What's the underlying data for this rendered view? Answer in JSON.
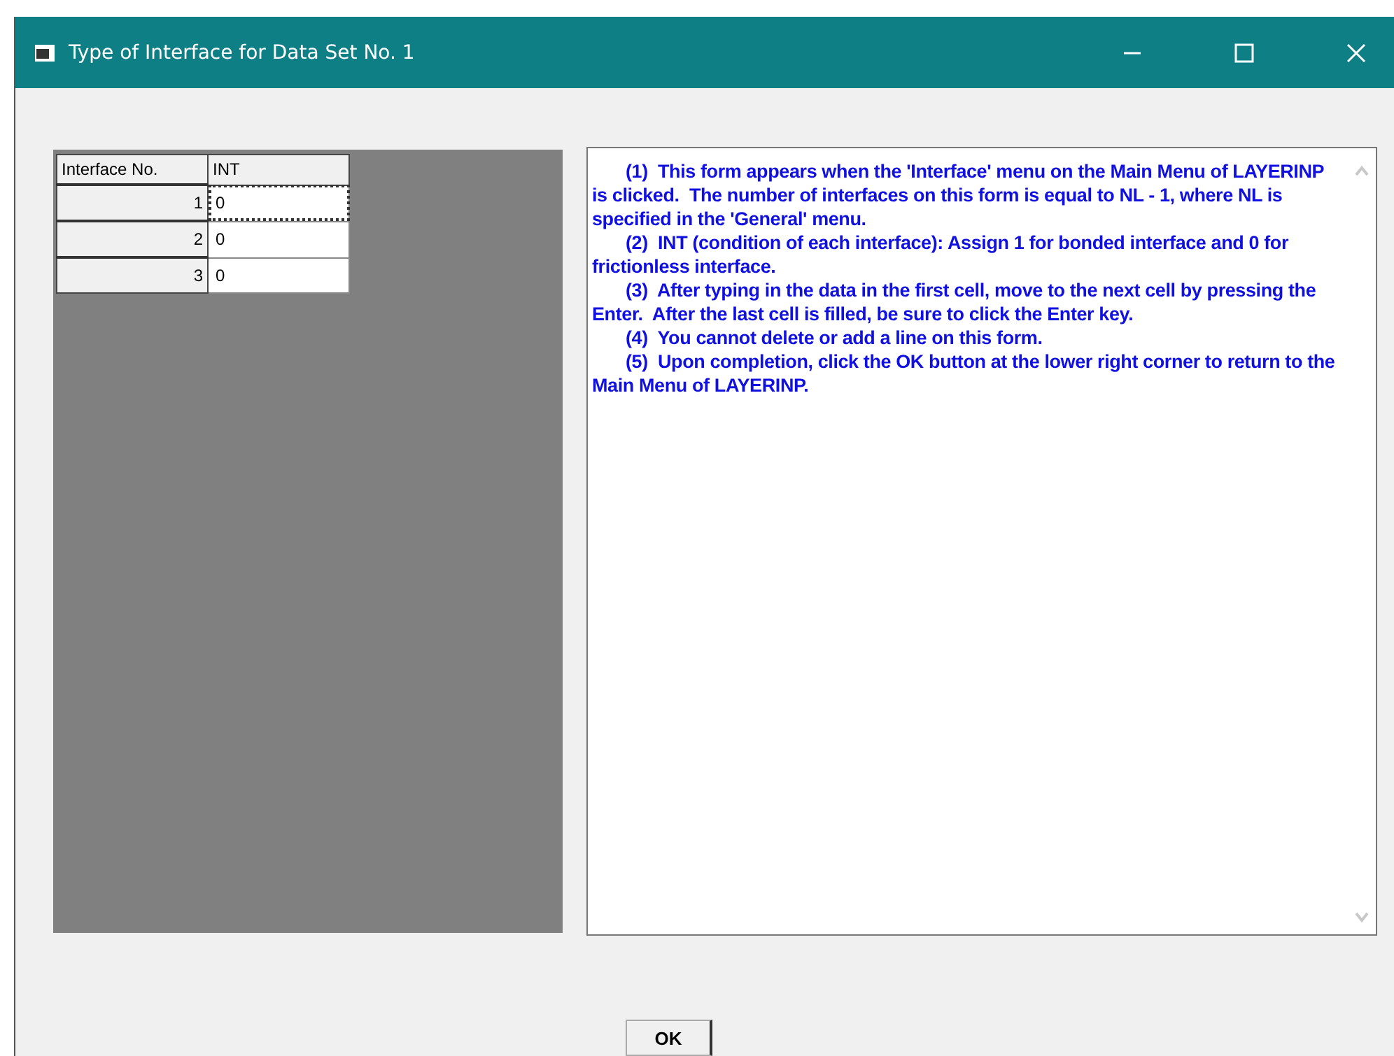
{
  "window": {
    "title": "Type of Interface for Data Set No. 1"
  },
  "table": {
    "columns": [
      "Interface No.",
      "INT"
    ],
    "rows": [
      {
        "number": "1",
        "int": "0",
        "focused": true
      },
      {
        "number": "2",
        "int": "0",
        "focused": false
      },
      {
        "number": "3",
        "int": "0",
        "focused": false
      }
    ]
  },
  "instructions": [
    "(1)  This form appears when the 'Interface' menu on the Main Menu of LAYERINP is clicked.  The number of interfaces on this form is equal to NL - 1, where NL is specified in the 'General' menu.",
    "(2)  INT (condition of each interface): Assign 1 for bonded interface and 0 for frictionless interface.",
    "(3)  After typing in the data in the first cell, move to the next cell by pressing the Enter.  After the last cell is filled, be sure to click the Enter key.",
    "(4)  You cannot delete or add a line on this form.",
    "(5)  Upon completion, click the OK button at the lower right corner to return to the Main Menu of LAYERINP."
  ],
  "buttons": [
    "OK"
  ]
}
